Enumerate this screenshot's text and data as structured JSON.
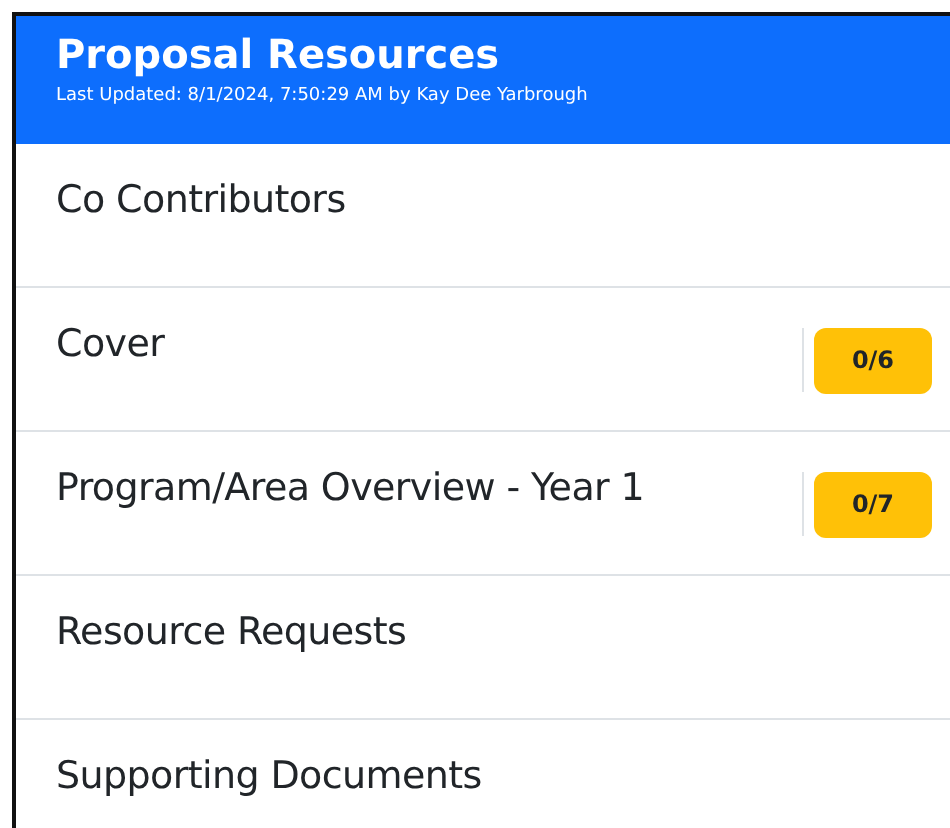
{
  "header": {
    "title": "Proposal Resources",
    "subtitle": "Last Updated: 8/1/2024, 7:50:29 AM by Kay Dee Yarbrough"
  },
  "items": [
    {
      "label": "Co Contributors"
    },
    {
      "label": "Cover",
      "badge": "0/6"
    },
    {
      "label": "Program/Area Overview - Year 1",
      "badge": "0/7"
    },
    {
      "label": "Resource Requests"
    },
    {
      "label": "Supporting Documents"
    }
  ]
}
